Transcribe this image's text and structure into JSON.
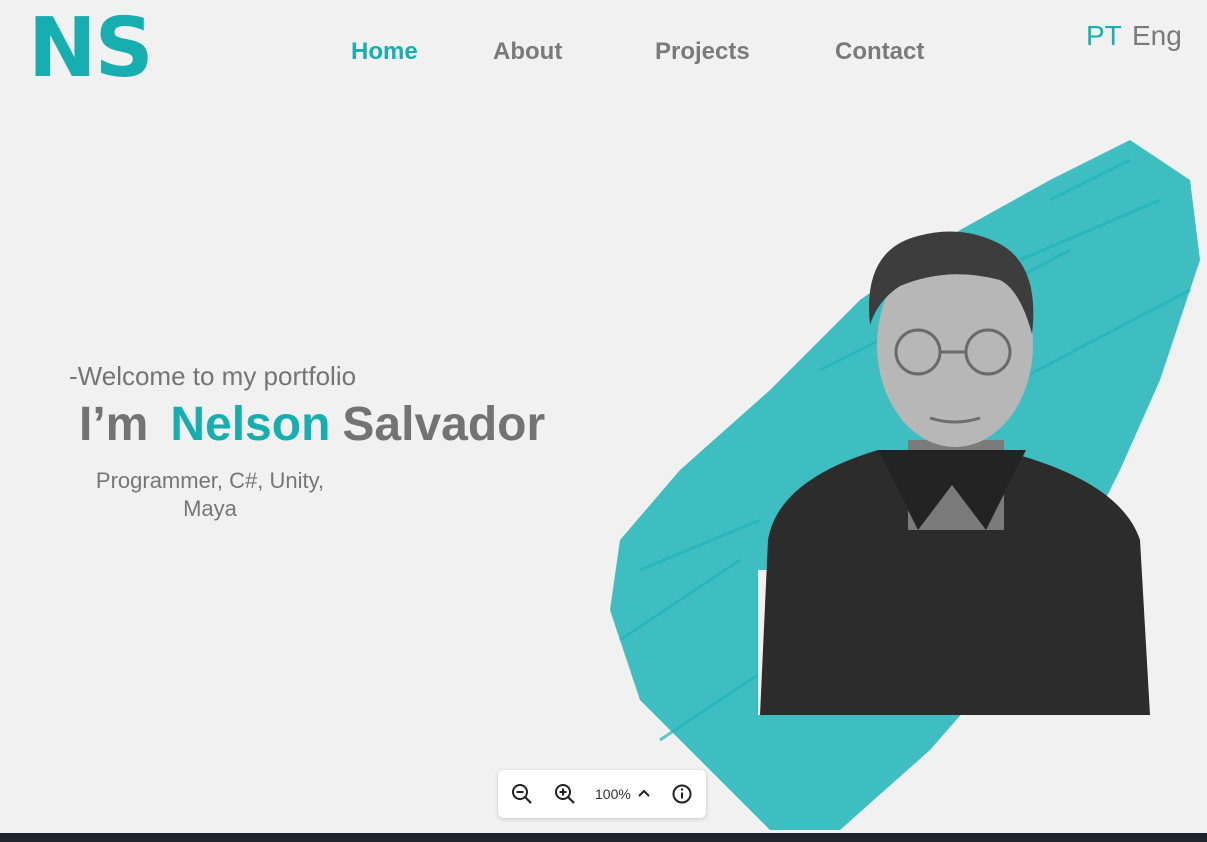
{
  "brand": {
    "logo_text": "NS",
    "accent_color": "#17aeb0"
  },
  "nav": {
    "items": [
      {
        "label": "Home",
        "active": true
      },
      {
        "label": "About"
      },
      {
        "label": "Projects"
      },
      {
        "label": "Contact"
      }
    ]
  },
  "languages": {
    "pt": "PT",
    "en": "Eng"
  },
  "hero": {
    "welcome": "-Welcome to my portfolio",
    "im": "I’m",
    "first_name": "Nelson",
    "last_name": "Salvador",
    "roles_line1": "Programmer, C#, Unity,",
    "roles_line2": "Maya",
    "photo_icon": "portrait-photo"
  },
  "viewer": {
    "zoom_level": "100%"
  },
  "icons": {
    "zoom_out": "zoom-out-icon",
    "zoom_in": "zoom-in-icon",
    "chevron": "chevron-up-icon",
    "info": "info-icon"
  }
}
